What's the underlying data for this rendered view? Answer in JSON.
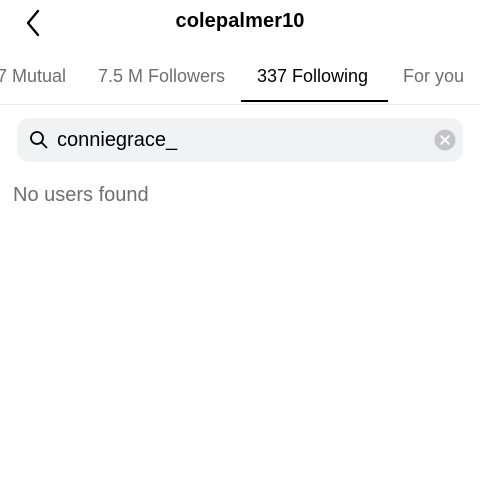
{
  "header": {
    "title": "colepalmer10",
    "back_icon": "chevron-left-icon"
  },
  "tabs": [
    {
      "label": "7 Mutual",
      "active": false
    },
    {
      "label": "7.5 M Followers",
      "active": false
    },
    {
      "label": "337 Following",
      "active": true
    },
    {
      "label": "For you",
      "active": false
    }
  ],
  "search": {
    "value": "conniegrace_",
    "icon": "search-icon",
    "clear_icon": "clear-icon"
  },
  "results": {
    "empty_message": "No users found"
  },
  "colors": {
    "text": "#000000",
    "secondary_text": "#6e6e73",
    "search_bg": "#f1f2f4",
    "clear_button": "#c4c4c9"
  }
}
